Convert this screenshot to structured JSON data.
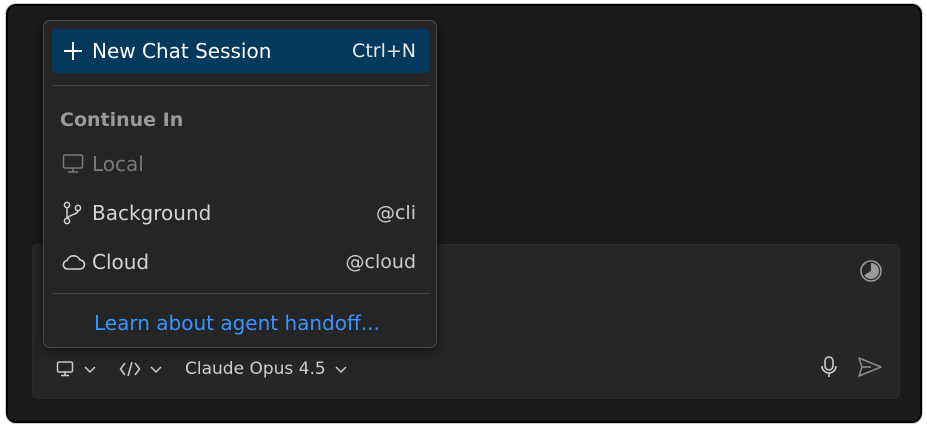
{
  "menu": {
    "new_chat": {
      "label": "New Chat Session",
      "shortcut": "Ctrl+N",
      "icon": "plus-icon"
    },
    "group_header": "Continue In",
    "items": [
      {
        "label": "Local",
        "hint": "",
        "icon": "monitor-icon",
        "disabled": true
      },
      {
        "label": "Background",
        "hint": "@cli",
        "icon": "git-branch-icon",
        "disabled": false
      },
      {
        "label": "Cloud",
        "hint": "@cloud",
        "icon": "cloud-icon",
        "disabled": false
      }
    ],
    "link_label": "Learn about agent handoff..."
  },
  "toolbar": {
    "model_label": "Claude Opus 4.5",
    "icons": [
      "monitor-icon",
      "chevron-down-icon",
      "code-icon",
      "chevron-down-icon",
      "microphone-icon",
      "send-icon",
      "context-usage-icon"
    ]
  },
  "colors": {
    "background": "#1b1b1b",
    "menu_background": "#252526",
    "active_item": "#04395e",
    "link": "#3794ff"
  }
}
